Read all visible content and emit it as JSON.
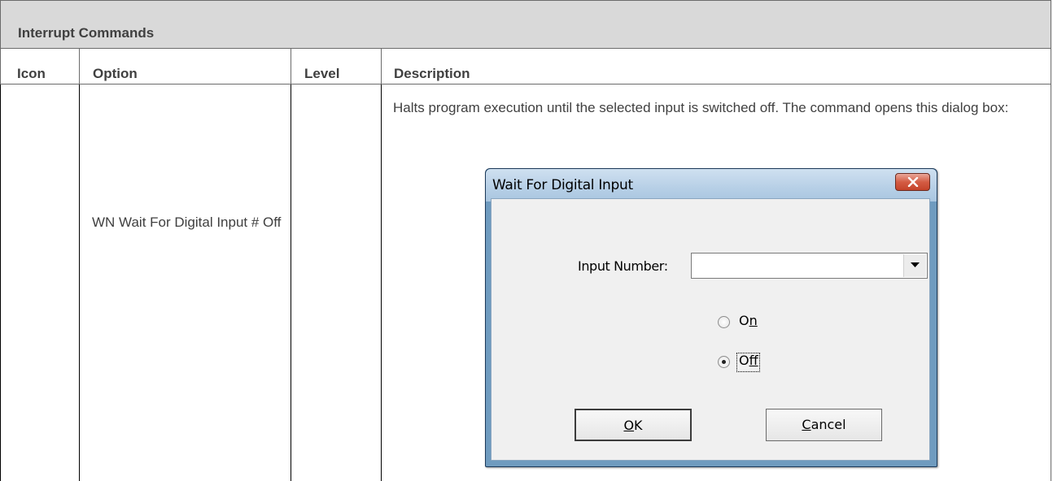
{
  "section": {
    "title": "Interrupt Commands"
  },
  "columns": {
    "icon": "Icon",
    "option": "Option",
    "level": "Level",
    "description": "Description"
  },
  "row": {
    "icon": "",
    "option": "WN Wait For Digital Input # Off",
    "level": "",
    "description": "Halts program execution until the selected input is switched off. The command opens this dialog box:"
  },
  "dialog": {
    "title": "Wait For Digital Input",
    "input_label": "Input Number:",
    "input_value": "",
    "radio_on_label": "On",
    "radio_off_label": "Off",
    "selected": "Off",
    "ok_label": "OK",
    "cancel_label": "Cancel"
  }
}
